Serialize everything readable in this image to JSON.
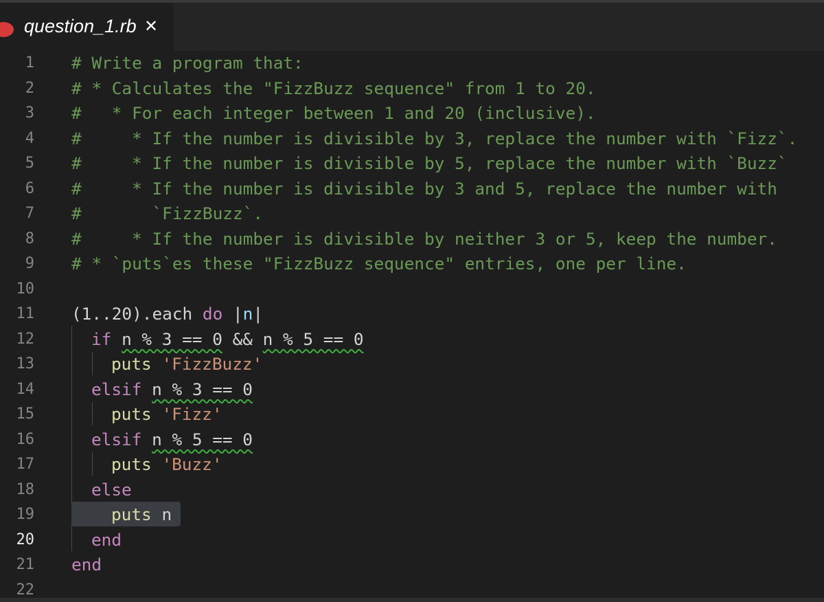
{
  "tab": {
    "filename": "question_1.rb",
    "close_glyph": "✕"
  },
  "line_numbers": [
    "1",
    "2",
    "3",
    "4",
    "5",
    "6",
    "7",
    "8",
    "9",
    "10",
    "11",
    "12",
    "13",
    "14",
    "15",
    "16",
    "17",
    "18",
    "19",
    "20",
    "21",
    "22"
  ],
  "active_line": "20",
  "code": {
    "l1": "# Write a program that:",
    "l2": "# * Calculates the \"FizzBuzz sequence\" from 1 to 20.",
    "l3": "#   * For each integer between 1 and 20 (inclusive).",
    "l4": "#     * If the number is divisible by 3, replace the number with `Fizz`.",
    "l5": "#     * If the number is divisible by 5, replace the number with `Buzz`",
    "l6": "#     * If the number is divisible by 3 and 5, replace the number with",
    "l7": "#       `FizzBuzz`.",
    "l8": "#     * If the number is divisible by neither 3 or 5, keep the number.",
    "l9": "# * `puts`es these \"FizzBuzz sequence\" entries, one per line.",
    "l11_a": "(1..20).each ",
    "l11_kw": "do",
    "l11_sp": " ",
    "l11_bar1": "|",
    "l11_n": "n",
    "l11_bar2": "|",
    "l12_kw": "if",
    "l12_cond1": "n % 3 == 0",
    "l12_and": " && ",
    "l12_cond2": "n % 5 == 0",
    "l13_fn": "puts",
    "l13_str": "'FizzBuzz'",
    "l14_kw": "elsif",
    "l14_cond": "n % 3 == 0",
    "l15_fn": "puts",
    "l15_str": "'Fizz'",
    "l16_kw": "elsif",
    "l16_cond": "n % 5 == 0",
    "l17_fn": "puts",
    "l17_str": "'Buzz'",
    "l18_kw": "else",
    "l19_fn": "puts",
    "l19_n": "n",
    "l20_kw": "end",
    "l21_kw": "end"
  },
  "colors": {
    "background": "#1e1e1e",
    "comment": "#6a9955",
    "keyword": "#c586c0",
    "string": "#ce9178",
    "function": "#dcdcaa",
    "tab_dot": "#d73a3a"
  }
}
